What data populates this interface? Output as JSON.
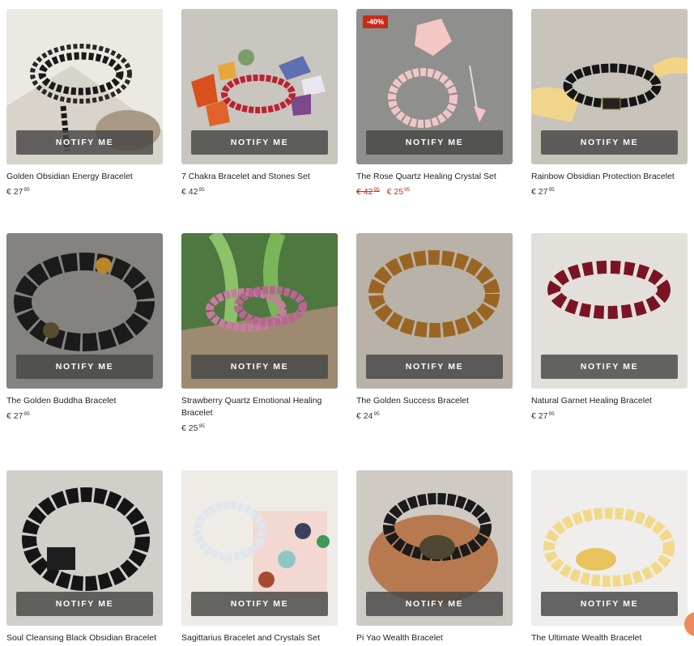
{
  "notify_label": "NOTIFY ME",
  "products": [
    {
      "name": "Golden Obsidian Energy Bracelet",
      "price": {
        "currency": "€",
        "main": "27",
        "cents": "95"
      }
    },
    {
      "name": "7 Chakra Bracelet and Stones Set",
      "price": {
        "currency": "€",
        "main": "42",
        "cents": "95"
      }
    },
    {
      "name": "The Rose Quartz Healing Crystal Set",
      "badge": "-40%",
      "old_price": {
        "currency": "€",
        "main": "42",
        "cents": "95"
      },
      "price": {
        "currency": "€",
        "main": "25",
        "cents": "95"
      }
    },
    {
      "name": "Rainbow Obsidian Protection Bracelet",
      "price": {
        "currency": "€",
        "main": "27",
        "cents": "95"
      }
    },
    {
      "name": "The Golden Buddha Bracelet",
      "price": {
        "currency": "€",
        "main": "27",
        "cents": "95"
      }
    },
    {
      "name": "Strawberry Quartz Emotional Healing Bracelet",
      "price": {
        "currency": "€",
        "main": "25",
        "cents": "95"
      }
    },
    {
      "name": "The Golden Success Bracelet",
      "price": {
        "currency": "€",
        "main": "24",
        "cents": "95"
      }
    },
    {
      "name": "Natural Garnet Healing Bracelet",
      "price": {
        "currency": "€",
        "main": "27",
        "cents": "95"
      }
    },
    {
      "name": "Soul Cleansing Black Obsidian Bracelet"
    },
    {
      "name": "Sagittarius Bracelet and Crystals Set"
    },
    {
      "name": "Pi Yao Wealth Bracelet"
    },
    {
      "name": "The Ultimate Wealth Bracelet"
    }
  ],
  "colors": {
    "sale_red": "#c62d17",
    "notify_bg": "#464646",
    "chat_accent": "#ef8a5a"
  }
}
